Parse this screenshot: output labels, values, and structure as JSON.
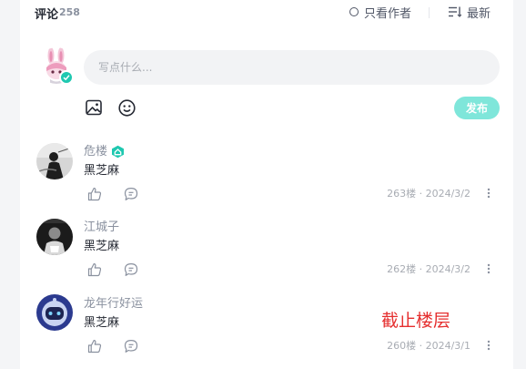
{
  "header": {
    "title": "评论",
    "count": "258",
    "author_only_label": "只看作者",
    "sort_label": "最新"
  },
  "composer": {
    "placeholder": "写点什么...",
    "publish_label": "发布"
  },
  "comments": [
    {
      "name": "危楼",
      "text": "黑芝麻",
      "floor": "263楼",
      "date": "2024/3/2"
    },
    {
      "name": "江城子",
      "text": "黑芝麻",
      "floor": "262楼",
      "date": "2024/3/2"
    },
    {
      "name": "龙年行好运",
      "text": "黑芝麻",
      "floor": "260楼",
      "date": "2024/3/1"
    }
  ],
  "meta_separator": "·",
  "annotation": "截止楼层",
  "colors": {
    "accent": "#1fc8b0",
    "publish_disabled": "#7fe6da",
    "annotation_red": "#e52f2f",
    "level_badge": "#1fc8b0"
  },
  "icons": {
    "image": "image-icon",
    "emoji": "emoji-icon",
    "like": "thumbs-up-icon",
    "reply": "comment-icon",
    "more": "more-vertical-icon",
    "sort": "sort-lines-icon",
    "verify": "checkmark-icon",
    "level": "level-house-badge-icon"
  }
}
